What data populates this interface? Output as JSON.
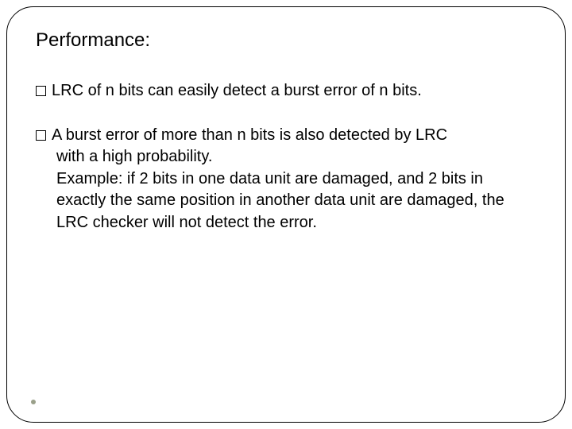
{
  "title": "Performance:",
  "bullets": [
    {
      "first": "LRC of n bits can easily detect a burst error of n bits."
    },
    {
      "first": "A burst error of more than n bits is also detected by LRC",
      "rest": "with a high probability.\nExample: if 2 bits in one data unit are damaged, and 2 bits in exactly the same position in another data unit are damaged, the LRC checker will not detect the error."
    }
  ]
}
